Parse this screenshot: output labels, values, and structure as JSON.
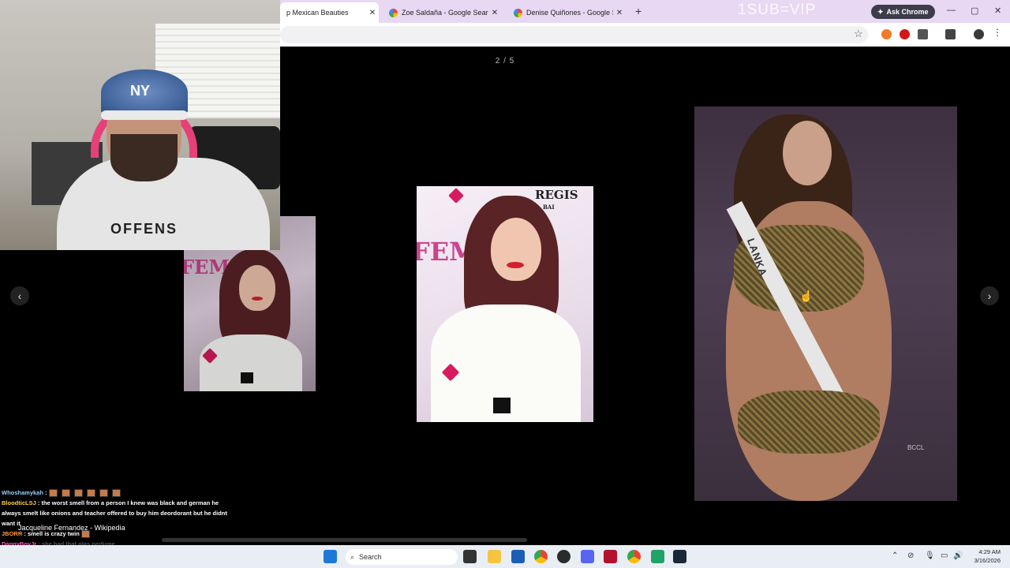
{
  "browser": {
    "tabs": [
      {
        "label": "p Mexican Beauties",
        "active": true
      },
      {
        "label": "Zoe Saldaña - Google Search",
        "active": false
      },
      {
        "label": "Denise Quiñones - Google Sea",
        "active": false
      }
    ],
    "new_tab_symbol": "+",
    "close_symbol": "✕",
    "ask_chrome_label": "Ask Chrome",
    "watermark": "1SUB=VIP",
    "window_controls": {
      "minimize": "—",
      "maximize": "▢",
      "close": "✕"
    },
    "bookmark_icon": "star-icon"
  },
  "viewer": {
    "counter": "2 / 5",
    "prev_symbol": "‹",
    "next_symbol": "›",
    "main_photo_brand": "REGIS",
    "main_photo_brand_sub": "BAI",
    "main_photo_fem": "FEMI",
    "side_photo_fem": "FEMI",
    "right_photo_sash": "LANKA",
    "right_photo_credit": "BCCL"
  },
  "webcam": {
    "cap_logo": "NY",
    "shirt_text": "OFFENS"
  },
  "chat": {
    "messages": [
      {
        "user": "Whoshamykah",
        "text": ":",
        "emotes": 6,
        "color": "u1"
      },
      {
        "user": "BloodticLSJ",
        "text": ": the worst smell from a person I knew was black and german he",
        "color": "u1"
      },
      {
        "user": "",
        "text": "always smelt like onions and teacher offered to buy him deordorant but he didnt",
        "color": ""
      },
      {
        "user": "",
        "text": "want it",
        "color": ""
      },
      {
        "user": "JBORR",
        "text": ": smell is crazy twin",
        "color": "u3"
      },
      {
        "user": "DannyBoyJr",
        "text": ": she had that glas perfume",
        "color": "u4"
      }
    ],
    "wiki_tooltip": "Jacqueline Fernandez - Wikipedia"
  },
  "taskbar": {
    "search_placeholder": "Search",
    "time": "4:29 AM",
    "date": "3/16/2026"
  },
  "colors": {
    "tab_strip": "#e8d8f3",
    "viewer_bg": "#000000",
    "taskbar": "#e9eef5"
  }
}
